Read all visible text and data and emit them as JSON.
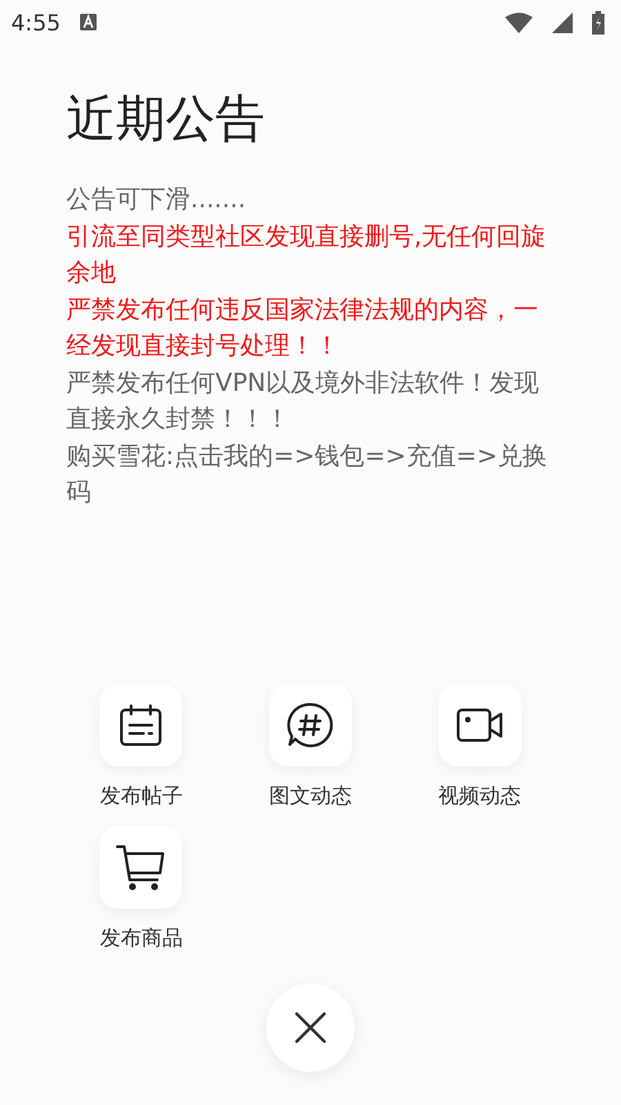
{
  "status_bar": {
    "time": "4:55"
  },
  "title": "近期公告",
  "notices": [
    {
      "text": "公告可下滑.......",
      "kind": "normal"
    },
    {
      "text": "引流至同类型社区发现直接删号,无任何回旋余地",
      "kind": "warning"
    },
    {
      "text": "严禁发布任何违反国家法律法规的内容，一经发现直接封号处理！！",
      "kind": "warning"
    },
    {
      "text": "严禁发布任何VPN以及境外非法软件！发现直接永久封禁！！！",
      "kind": "normal"
    },
    {
      "text": "购买雪花:点击我的=>钱包=>充值=>兑换码",
      "kind": "normal"
    }
  ],
  "actions": [
    {
      "label": "发布帖子",
      "kind": "post"
    },
    {
      "label": "图文动态",
      "kind": "hashtag"
    },
    {
      "label": "视频动态",
      "kind": "video"
    },
    {
      "label": "发布商品",
      "kind": "cart"
    }
  ]
}
